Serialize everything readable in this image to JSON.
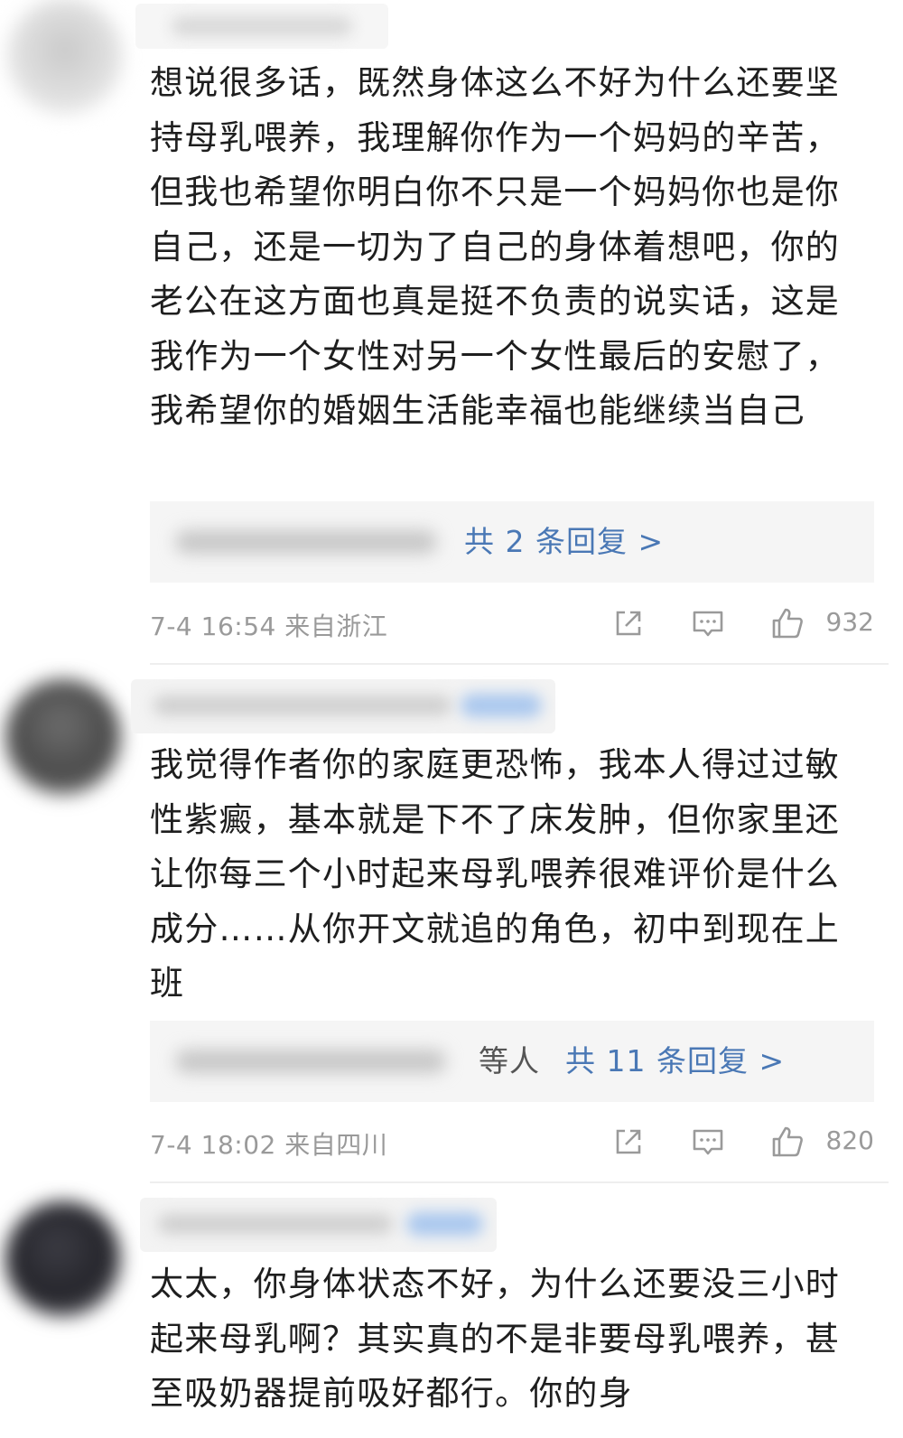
{
  "comments": [
    {
      "text": "想说很多话，既然身体这么不好为什么还要坚持母乳喂养，我理解你作为一个妈妈的辛苦，但我也希望你明白你不只是一个妈妈你也是你自己，还是一切为了自己的身体着想吧，你的老公在这方面也真是挺不负责的说实话，这是我作为一个女性对另一个女性最后的安慰了，我希望你的婚姻生活能幸福也能继续当自己",
      "reply_others": "",
      "reply_link": "共 2 条回复 >",
      "time": "7-4 16:54  来自浙江",
      "likes": "932"
    },
    {
      "text": "我觉得作者你的家庭更恐怖，我本人得过过敏性紫癜，基本就是下不了床发肿，但你家里还让你每三个小时起来母乳喂养很难评价是什么成分……从你开文就追的角色，初中到现在上班",
      "reply_others": "等人",
      "reply_link": "共 11 条回复 >",
      "time": "7-4 18:02  来自四川",
      "likes": "820"
    },
    {
      "text": "太太，你身体状态不好，为什么还要没三小时起来母乳啊？其实真的不是非要母乳喂养，甚至吸奶器提前吸好都行。你的身"
    }
  ],
  "colors": {
    "link": "#4a78b5",
    "meta": "#9a9a9a",
    "reply_bg": "#f5f5f5"
  },
  "icons": [
    "share-icon",
    "comment-icon",
    "like-icon"
  ]
}
